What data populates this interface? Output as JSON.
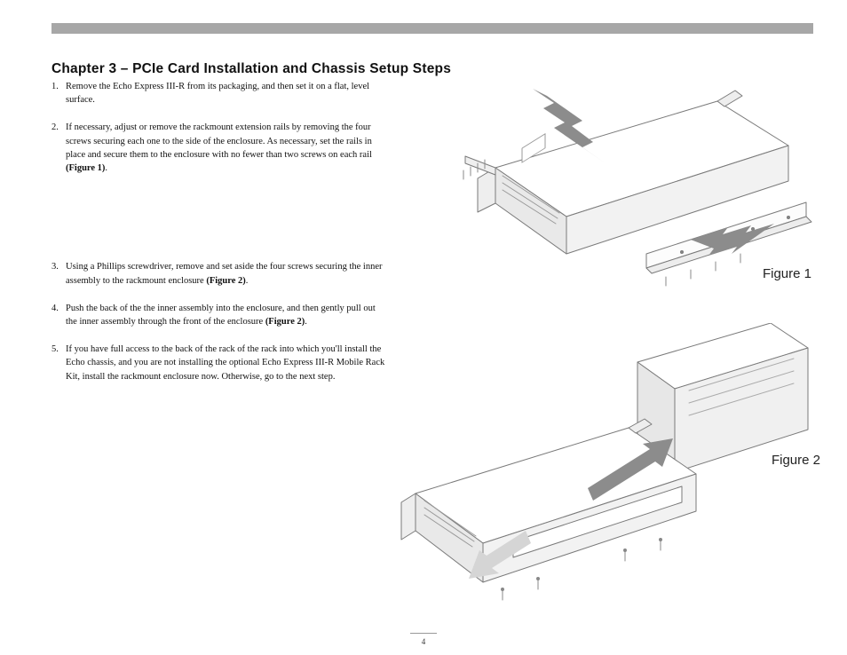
{
  "chapter_title": "Chapter 3 – PCIe Card Installation and Chassis Setup Steps",
  "steps": [
    {
      "text": "Remove the Echo Express III-R from its packaging, and then set it on a flat, level surface."
    },
    {
      "text": "If necessary, adjust or remove the rackmount extension rails by removing the four screws securing each one to the side of the enclosure. As necessary, set the rails in place and secure them to the enclosure with no fewer than two screws on each rail ",
      "bold_suffix": "(Figure 1)",
      "trailing": "."
    },
    {
      "text": "Using a Phillips screwdriver, remove and set aside the four screws securing the inner assembly to the rackmount enclosure ",
      "bold_suffix": "(Figure 2)",
      "trailing": "."
    },
    {
      "text": "Push the back of the the inner assembly into the enclosure, and then gently pull out the inner assembly through the front of the enclosure ",
      "bold_suffix": "(Figure 2)",
      "trailing": "."
    },
    {
      "text": "If you have full access to the back of the rack of the rack into which you'll install the Echo chassis, and you are not installing the optional Echo Express III-R Mobile Rack Kit, install the rackmount enclosure now. Otherwise, go to the next step."
    }
  ],
  "step3_gap_top": 260,
  "figures": {
    "f1": "Figure 1",
    "f2": "Figure 2"
  },
  "page_number": "4"
}
